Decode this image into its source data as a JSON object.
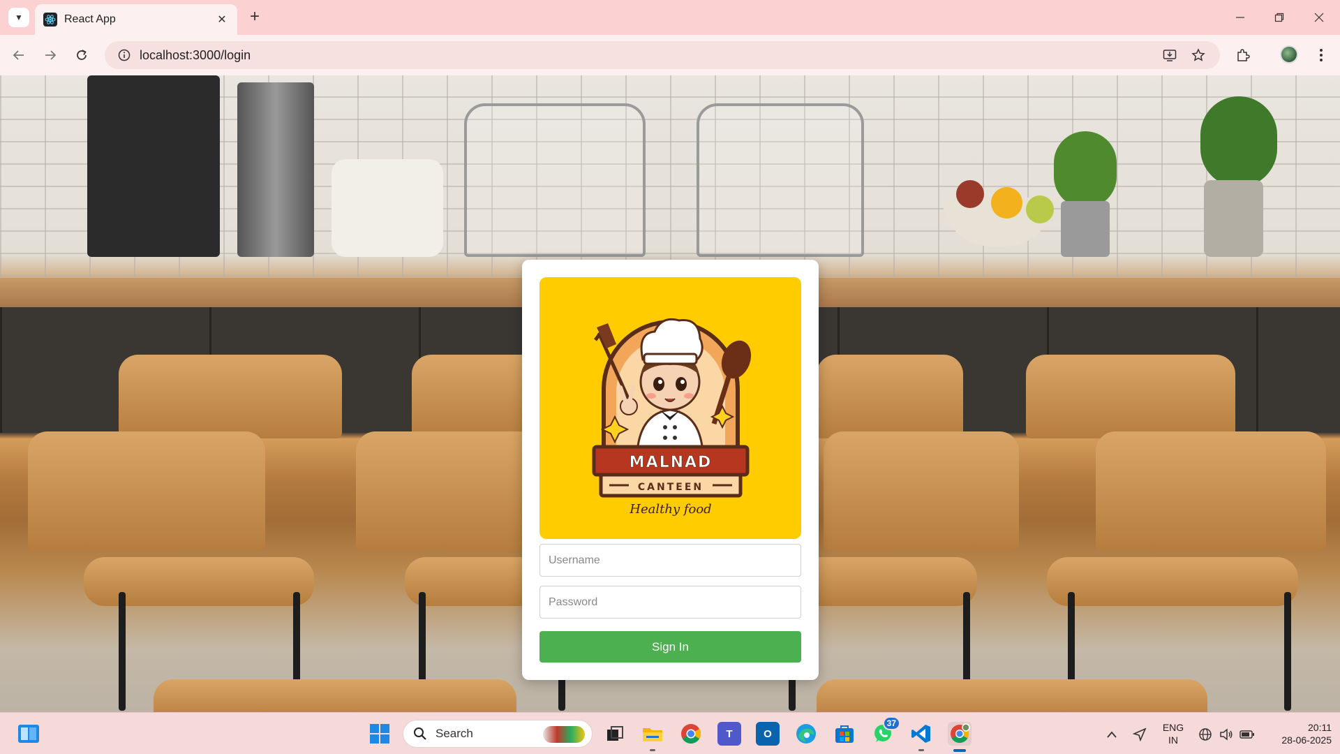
{
  "browser": {
    "tab_title": "React App",
    "url": "localhost:3000/login",
    "new_tab_symbol": "+",
    "tab_close_symbol": "✕"
  },
  "login": {
    "logo_brand": "MALNAD",
    "logo_sub": "CANTEEN",
    "logo_tagline": "Healthy food",
    "username_placeholder": "Username",
    "password_placeholder": "Password",
    "signin_label": "Sign In",
    "accent_color": "#4caf50",
    "logo_bg_color": "#ffcc00"
  },
  "taskbar": {
    "search_label": "Search",
    "whatsapp_badge": "37",
    "language_line1": "ENG",
    "language_line2": "IN",
    "time": "20:11",
    "date": "28-06-2025",
    "apps": [
      "start-icon",
      "file-explorer-icon",
      "chrome-icon",
      "teams-icon",
      "outlook-icon",
      "edge-icon",
      "store-icon",
      "whatsapp-icon",
      "vscode-icon",
      "chrome-profile-icon"
    ]
  }
}
